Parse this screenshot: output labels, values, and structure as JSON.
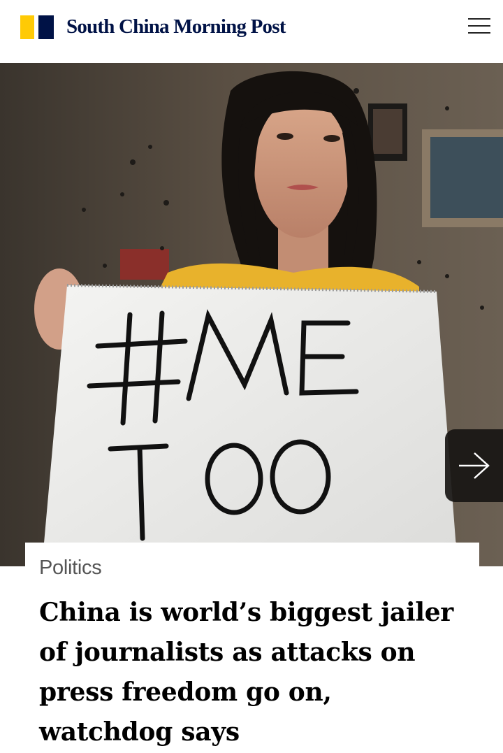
{
  "header": {
    "brand": "South China Morning Post",
    "logo_colors": {
      "yellow": "#FFCA05",
      "navy": "#001246"
    },
    "menu_icon": "hamburger-menu-icon"
  },
  "hero": {
    "sign_line1": "#ME",
    "sign_line2": "TOO",
    "next_icon": "arrow-right-icon"
  },
  "article": {
    "section": "Politics",
    "headline": "China is world’s biggest jailer of journalists as attacks on press freedom go on, watchdog says"
  }
}
